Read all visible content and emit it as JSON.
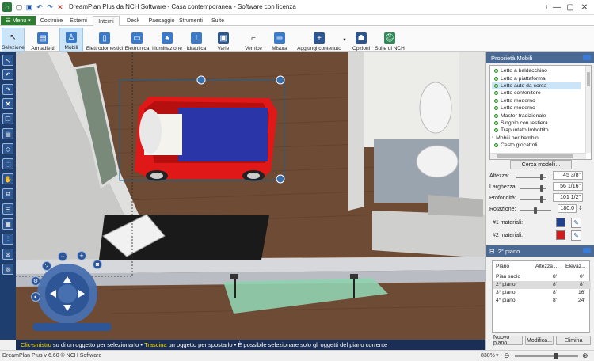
{
  "window": {
    "title": "DreamPlan Plus da NCH Software - Casa contemporanea - Software con licenza",
    "controls": [
      "minimize",
      "maximize",
      "close"
    ]
  },
  "menu": {
    "label": "Menu"
  },
  "tabs": [
    "Costruire",
    "Esterni",
    "Interni",
    "Deck",
    "Paesaggio",
    "Strumenti",
    "Suite"
  ],
  "active_tab": "Interni",
  "toolbar": [
    {
      "label": "Selezione",
      "icon": "cursor-icon",
      "selected": true
    },
    {
      "label": "Armadietti",
      "icon": "cabinet-icon"
    },
    {
      "label": "Mobili",
      "icon": "chair-icon",
      "selected": true
    },
    {
      "label": "Elettrodomestici",
      "icon": "fridge-icon"
    },
    {
      "label": "Elettronica",
      "icon": "tv-icon"
    },
    {
      "label": "Illuminazione",
      "icon": "lamp-icon"
    },
    {
      "label": "Idraulica",
      "icon": "faucet-icon"
    },
    {
      "label": "Varie",
      "icon": "frame-icon"
    },
    {
      "label": "Vernice",
      "icon": "paint-icon"
    },
    {
      "label": "Misura",
      "icon": "ruler-icon"
    },
    {
      "label": "Aggiungi contenuto",
      "icon": "add-content-icon"
    },
    {
      "label": "Opzioni",
      "icon": "options-icon"
    },
    {
      "label": "Suite di NCH",
      "icon": "suite-icon"
    }
  ],
  "hint": {
    "part1": "Clic-sinistro",
    "part2": " su di un oggetto per selezionarlo • ",
    "part3": "Trascina",
    "part4": " un oggetto per spostarlo • È possibile selezionare solo gli oggetti del piano corrente"
  },
  "status": {
    "version": "DreamPlan Plus v 6.60 © NCH Software",
    "zoom": "838%"
  },
  "properties": {
    "title": "Proprietà Mobili",
    "items": [
      "Letto a baldacchino",
      "Letto a piattaforma",
      "Letto auto da corsa",
      "Letto contenitore",
      "Letto moderno",
      "Letto moderno",
      "Master tradizionale",
      "Singolo con testiera",
      "Trapuntato Imbottito",
      "Mobili per bambini",
      "Cesto giocattoli"
    ],
    "selected_item": "Letto auto da corsa",
    "search_button": "Cerca modelli...",
    "altezza_label": "Altezza:",
    "altezza": "45 3/8\"",
    "larghezza_label": "Larghezza:",
    "larghezza": "56 1/16\"",
    "profondita_label": "Profondità:",
    "profondita": "101 1/2\"",
    "rotazione_label": "Rotazione:",
    "rotazione": "180.0",
    "mat1_label": "#1 materiali:",
    "mat1_color": "#1f3f8f",
    "mat2_label": "#2 materiali:",
    "mat2_color": "#d01c1c"
  },
  "floors": {
    "title": "2° piano",
    "headers": [
      "Piano",
      "Altezza ...",
      "Elevaz..."
    ],
    "rows": [
      [
        "Pian suolo",
        "8'",
        "0'"
      ],
      [
        "2° piano",
        "8'",
        "8'"
      ],
      [
        "3° piano",
        "8'",
        "16'"
      ],
      [
        "4° piano",
        "8'",
        "24'"
      ]
    ],
    "selected_row": 1,
    "buttons": [
      "Nuovo piano",
      "Modifica...",
      "Elimina"
    ]
  }
}
